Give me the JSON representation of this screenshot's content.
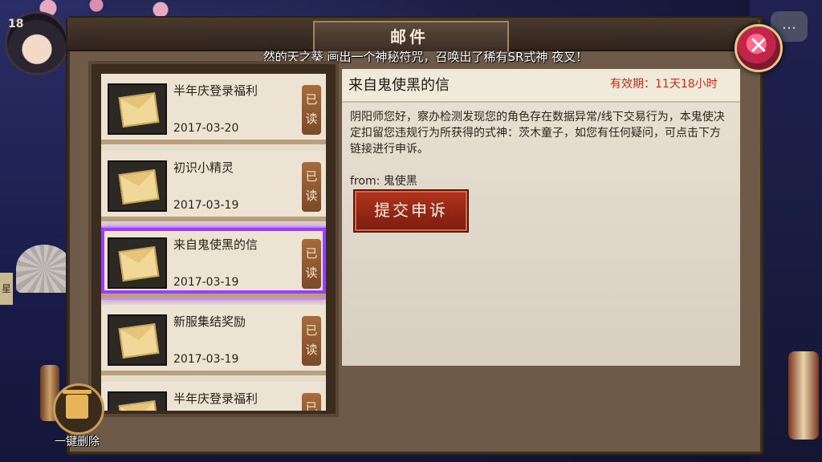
{
  "hud": {
    "level": "18"
  },
  "window": {
    "title": "邮件"
  },
  "marquee": "然的天之葵 画出一个神秘符咒，召唤出了稀有SR式神 夜叉！",
  "mail_list": [
    {
      "title": "半年庆登录福利",
      "date": "2017-03-20",
      "status": "已读"
    },
    {
      "title": "初识小精灵",
      "date": "2017-03-19",
      "status": "已读"
    },
    {
      "title": "来自鬼使黑的信",
      "date": "2017-03-19",
      "status": "已读"
    },
    {
      "title": "新服集结奖励",
      "date": "2017-03-19",
      "status": "已读"
    },
    {
      "title": "半年庆登录福利",
      "date": "",
      "status": "已读"
    }
  ],
  "selected_mail": {
    "title": "来自鬼使黑的信",
    "validity": "有效期：11天18小时",
    "body": "阴阳师您好，察办检测发现您的角色存在数据异常/线下交易行为，本鬼使决定扣留您违规行为所获得的式神：茨木童子，如您有任何疑问，可点击下方链接进行申诉。",
    "from": "from: 鬼使黑",
    "action_label": "提交申诉"
  },
  "footer": {
    "delete_all_label": "一键删除"
  },
  "colors": {
    "accent_red": "#c0301a",
    "selection_purple": "#9c3cff"
  }
}
